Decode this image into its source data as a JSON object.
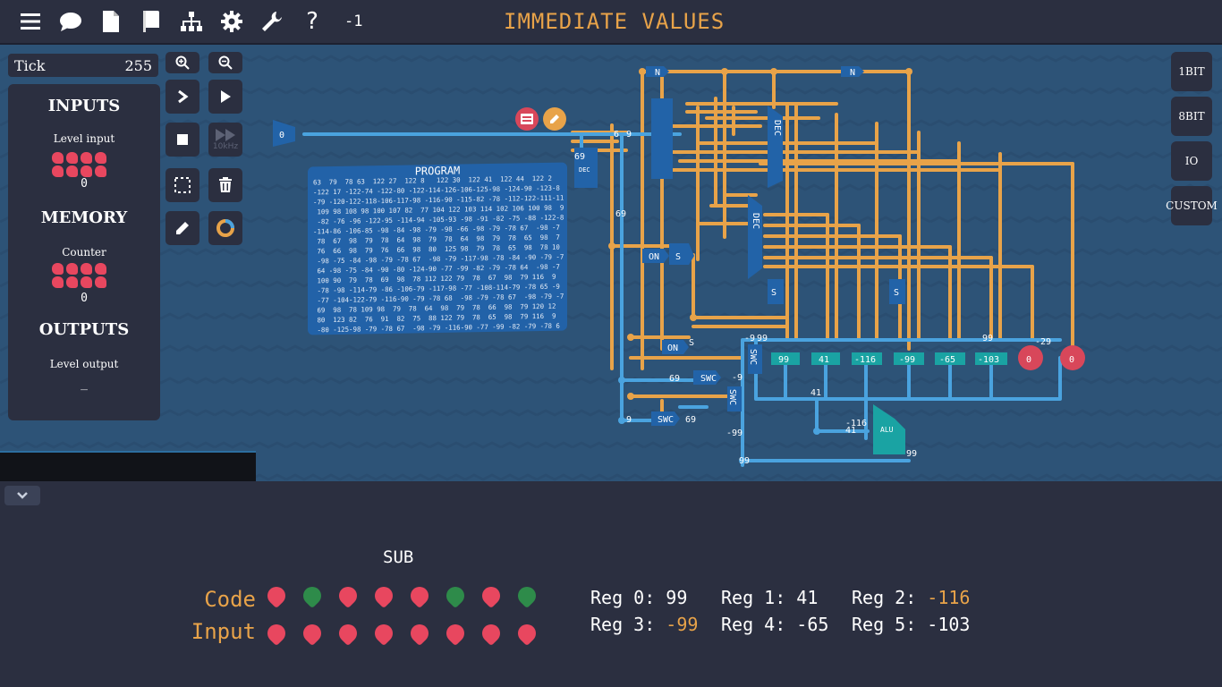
{
  "topbar": {
    "icons": [
      "menu-icon",
      "chat-icon",
      "document-icon",
      "book-icon",
      "hierarchy-icon",
      "gear-icon",
      "wrench-icon",
      "help-icon"
    ],
    "level_number": "-1",
    "level_title": "IMMEDIATE VALUES"
  },
  "tick": {
    "label": "Tick",
    "value": "255"
  },
  "side_panel": {
    "inputs_heading": "INPUTS",
    "input_label": "Level input",
    "input_value": "0",
    "memory_heading": "MEMORY",
    "memory_label": "Counter",
    "memory_value": "0",
    "outputs_heading": "OUTPUTS",
    "output_label": "Level output",
    "output_value": "_"
  },
  "tools": {
    "speed_label": "10kHz"
  },
  "right_buttons": [
    "1BIT",
    "8BIT",
    "IO",
    "CUSTOM"
  ],
  "program": {
    "title": "PROGRAM",
    "lines": [
      "63  79  78 63  122 27  122 8   122 30  122 41  122 44  122 2",
      "-122 17 -122-74 -122-80 -122-114-126-106-125-98 -124-90 -123-8",
      "-79 -120-122-118-106-117-98 -116-90 -115-82 -78 -112-122-111-11",
      " 109 98 108 98 100 107 82  77 104 122 103 114 102 106 100 98  9",
      " -82 -76 -96 -122-95 -114-94 -105-93 -98 -91 -82 -75 -88 -122-8",
      "-114-86 -106-85 -98 -84 -98 -79 -98 -66 -98 -79 -78 67  -98 -7",
      " 78  67  98  79  78  64  98  79  78  64  98  79  78  65  98  7",
      " 76  66  98  79  76  66  98  80  125 98  79  78  65  98  78 10",
      " -98 -75 -84 -98 -79 -78 67  -98 -79 -117-98 -78 -84 -90 -79 -7",
      " 64 -98 -75 -84 -90 -80 -124-90 -77 -99 -82 -79 -78 64  -98 -7",
      " 100 90  79  78  69  98  78 112 122 79  78  67  98  79 116  9",
      " -78 -98 -114-79 -86 -106-79 -117-98 -77 -108-114-79 -78 65 -9",
      " -77 -104-122-79 -116-90 -79 -78 68  -98 -79 -78 67  -98 -79 -7",
      " 69  98  78 109 98  79  78  64  98  79  78  66  98  79 120 12",
      " 80  123 82  76  91  82  75  88 122 79  78  65  98  79 116  9",
      " -80 -125-98 -79 -78 67  -98 -79 -116-90 -77 -99 -82 -79 -78 6"
    ],
    "highlight": "69"
  },
  "circuit": {
    "labels": [
      "0",
      "69",
      "69",
      "69",
      "9",
      "69",
      "-9",
      "9",
      "41",
      "-116",
      "-99",
      "-65",
      "-103",
      "0",
      "0",
      "-99",
      "99",
      "41",
      "-116",
      "41",
      "99",
      "99",
      "-99",
      "-9",
      "9",
      "-103"
    ],
    "components": [
      "N",
      "N",
      "DEC",
      "DEC",
      "ON",
      "S",
      "ON",
      "S",
      "S",
      "S",
      "SWC",
      "SWC",
      "SWC",
      "ALU",
      "REG",
      "DEC"
    ],
    "register_values": [
      "99",
      "41",
      "-116",
      "-99",
      "-65",
      "-103"
    ],
    "output_values": [
      "0",
      "0"
    ]
  },
  "bottom": {
    "operation": "SUB",
    "code_label": "Code",
    "input_label": "Input",
    "code_bits": [
      "r",
      "g",
      "r",
      "r",
      "r",
      "g",
      "r",
      "g"
    ],
    "input_bits": [
      "r",
      "r",
      "r",
      "r",
      "r",
      "r",
      "r",
      "r"
    ],
    "registers": [
      {
        "label": "Reg 0:",
        "value": "99",
        "neg": false
      },
      {
        "label": "Reg 1:",
        "value": "41",
        "neg": false
      },
      {
        "label": "Reg 2:",
        "value": "-116",
        "neg": true
      },
      {
        "label": "Reg 3:",
        "value": "-99",
        "neg": true
      },
      {
        "label": "Reg 4:",
        "value": "-65",
        "neg": false
      },
      {
        "label": "Reg 5:",
        "value": "-103",
        "neg": false
      }
    ]
  },
  "colors": {
    "accent": "#e8a349",
    "wire_orange": "#e8a349",
    "wire_blue": "#4aa3df",
    "bit_red": "#e8475f",
    "bit_green": "#2e8b4a",
    "bg": "#2b2f40",
    "canvas": "#2d5377"
  }
}
